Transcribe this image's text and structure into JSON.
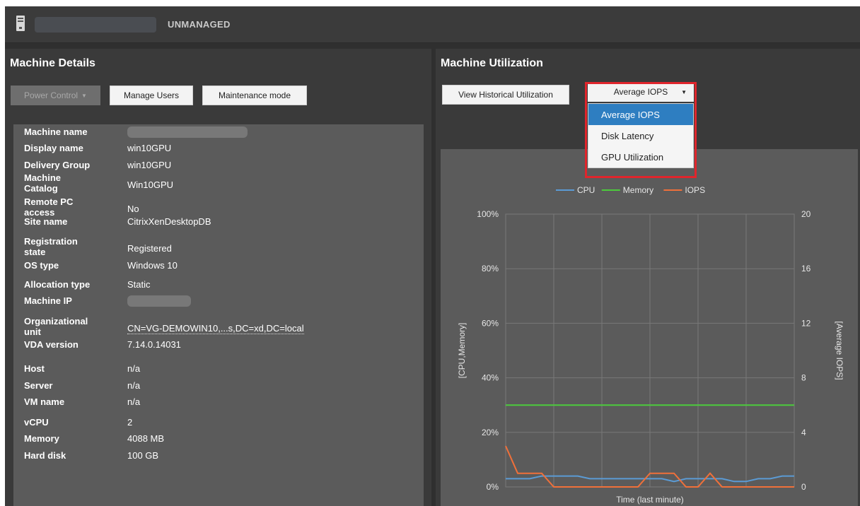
{
  "header": {
    "status": "UNMANAGED"
  },
  "machine_details": {
    "title": "Machine Details",
    "buttons": {
      "power_control": "Power Control",
      "manage_users": "Manage Users",
      "maintenance_mode": "Maintenance mode"
    },
    "fields": [
      {
        "key": "Machine name",
        "value": ""
      },
      {
        "key": "Display name",
        "value": "win10GPU"
      },
      {
        "key": "Delivery Group",
        "value": "win10GPU"
      },
      {
        "key": "Machine\nCatalog",
        "value": "Win10GPU"
      },
      {
        "key": "Remote PC\naccess",
        "value": "No"
      },
      {
        "key": "Site name",
        "value": "CitrixXenDesktopDB"
      },
      {
        "key": "Registration\nstate",
        "value": "Registered"
      },
      {
        "key": "OS type",
        "value": "Windows 10"
      },
      {
        "key": "Allocation type",
        "value": "Static"
      },
      {
        "key": "Machine IP",
        "value": ""
      },
      {
        "key": "Organizational\nunit",
        "value": "CN=VG-DEMOWIN10,...s,DC=xd,DC=local"
      },
      {
        "key": "VDA version",
        "value": "7.14.0.14031"
      },
      {
        "key": "Host",
        "value": "n/a"
      },
      {
        "key": "Server",
        "value": "n/a"
      },
      {
        "key": "VM name",
        "value": "n/a"
      },
      {
        "key": "vCPU",
        "value": "2"
      },
      {
        "key": "Memory",
        "value": "4088 MB"
      },
      {
        "key": "Hard disk",
        "value": "100 GB"
      }
    ]
  },
  "machine_utilization": {
    "title": "Machine Utilization",
    "historical_button": "View Historical Utilization",
    "select": {
      "selected": "Average IOPS",
      "options": [
        "Average IOPS",
        "Disk Latency",
        "GPU Utilization"
      ]
    }
  },
  "colors": {
    "cpu": "#5b9bd5",
    "memory": "#4ccb3c",
    "iops": "#f0703a",
    "highlight": "#e0252c",
    "selected_option": "#2e7ec1"
  },
  "chart_data": {
    "type": "line",
    "xlabel": "Time (last minute)",
    "ylabel": "[CPU,Memory]",
    "y2label": "[Average IOPS]",
    "ylim": [
      0,
      100
    ],
    "y2lim": [
      0,
      20
    ],
    "yticks": [
      "0%",
      "20%",
      "40%",
      "60%",
      "80%",
      "100%"
    ],
    "y2ticks": [
      "0",
      "4",
      "8",
      "12",
      "16",
      "20"
    ],
    "grid": true,
    "legend_position": "top",
    "x": [
      0,
      1,
      2,
      3,
      4,
      5,
      6,
      7,
      8,
      9,
      10,
      11,
      12,
      13,
      14,
      15,
      16,
      17,
      18,
      19,
      20,
      21,
      22,
      23,
      24
    ],
    "series": [
      {
        "name": "CPU",
        "axis": "left",
        "values": [
          3,
          3,
          3,
          4,
          4,
          4,
          4,
          3,
          3,
          3,
          3,
          3,
          3,
          3,
          2,
          3,
          3,
          3,
          3,
          2,
          2,
          3,
          3,
          4,
          4
        ]
      },
      {
        "name": "Memory",
        "axis": "left",
        "values": [
          30,
          30,
          30,
          30,
          30,
          30,
          30,
          30,
          30,
          30,
          30,
          30,
          30,
          30,
          30,
          30,
          30,
          30,
          30,
          30,
          30,
          30,
          30,
          30,
          30
        ]
      },
      {
        "name": "IOPS",
        "axis": "right",
        "values": [
          3,
          1,
          1,
          1,
          0,
          0,
          0,
          0,
          0,
          0,
          0,
          0,
          1,
          1,
          1,
          0,
          0,
          1,
          0,
          0,
          0,
          0,
          0,
          0,
          0
        ]
      }
    ]
  }
}
